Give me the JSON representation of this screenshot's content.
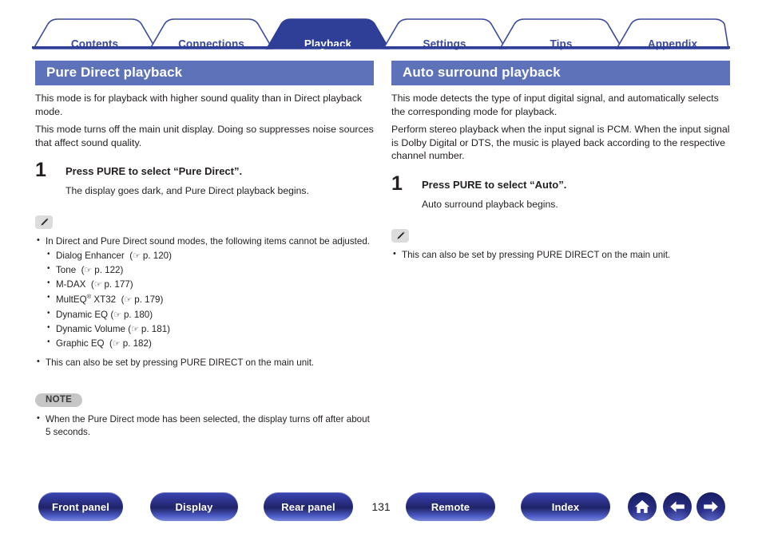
{
  "colors": {
    "tab_active_bg": "#2f3f97",
    "tab_inactive_text": "#3b4a9e",
    "section_header_bg": "#5d72b9",
    "rule": "#2f3f97",
    "note_badge_bg": "#c6c6c6"
  },
  "tabs": [
    {
      "label": "Contents",
      "active": false
    },
    {
      "label": "Connections",
      "active": false
    },
    {
      "label": "Playback",
      "active": true
    },
    {
      "label": "Settings",
      "active": false
    },
    {
      "label": "Tips",
      "active": false
    },
    {
      "label": "Appendix",
      "active": false
    }
  ],
  "left_column": {
    "heading": "Pure Direct playback",
    "paragraphs": [
      "This mode is for playback with higher sound quality than in Direct playback mode.",
      "This mode turns off the main unit display. Doing so suppresses noise sources that affect sound quality."
    ],
    "step": {
      "number": "1",
      "title": "Press PURE to select “Pure Direct”.",
      "body": "The display goes dark, and Pure Direct playback begins."
    },
    "note_icon": "pencil-icon",
    "bullets": [
      "In Direct and Pure Direct sound modes, the following items cannot be adjusted."
    ],
    "sub_bullets": [
      {
        "name": "Dialog Enhancer",
        "sup": "",
        "suffix": "",
        "ref": "p. 120"
      },
      {
        "name": "Tone",
        "sup": "",
        "suffix": "",
        "ref": "p. 122"
      },
      {
        "name": "M-DAX",
        "sup": "",
        "suffix": "",
        "ref": "p. 177"
      },
      {
        "name": "MultEQ",
        "sup": "®",
        "suffix": " XT32",
        "ref": "p. 179"
      },
      {
        "name": "Dynamic EQ",
        "sup": "",
        "suffix": "",
        "ref": "p. 180"
      },
      {
        "name": "Dynamic Volume",
        "sup": "",
        "suffix": "",
        "ref": "p. 181"
      },
      {
        "name": "Graphic EQ",
        "sup": "",
        "suffix": "",
        "ref": "p. 182"
      }
    ],
    "bullets_after": [
      "This can also be set by pressing PURE DIRECT on the main unit."
    ],
    "note_label": "NOTE",
    "note_bullets": [
      "When the Pure Direct mode has been selected, the display turns off after about 5 seconds."
    ]
  },
  "right_column": {
    "heading": "Auto surround playback",
    "paragraphs": [
      "This mode detects the type of input digital signal, and automatically selects the corresponding mode for playback.",
      "Perform stereo playback when the input signal is PCM. When the input signal is Dolby Digital or DTS, the music is played back according to the respective channel number."
    ],
    "step": {
      "number": "1",
      "title": "Press PURE to select “Auto”.",
      "body": "Auto surround playback begins."
    },
    "note_icon": "pencil-icon",
    "bullets": [
      "This can also be set by pressing PURE DIRECT on the main unit."
    ]
  },
  "footer": {
    "buttons": [
      {
        "label": "Front panel"
      },
      {
        "label": "Display"
      },
      {
        "label": "Rear panel"
      },
      {
        "label": "Remote"
      },
      {
        "label": "Index"
      }
    ],
    "page_number": "131",
    "nav_icons": [
      {
        "name": "home-icon"
      },
      {
        "name": "arrow-left-icon"
      },
      {
        "name": "arrow-right-icon"
      }
    ]
  }
}
